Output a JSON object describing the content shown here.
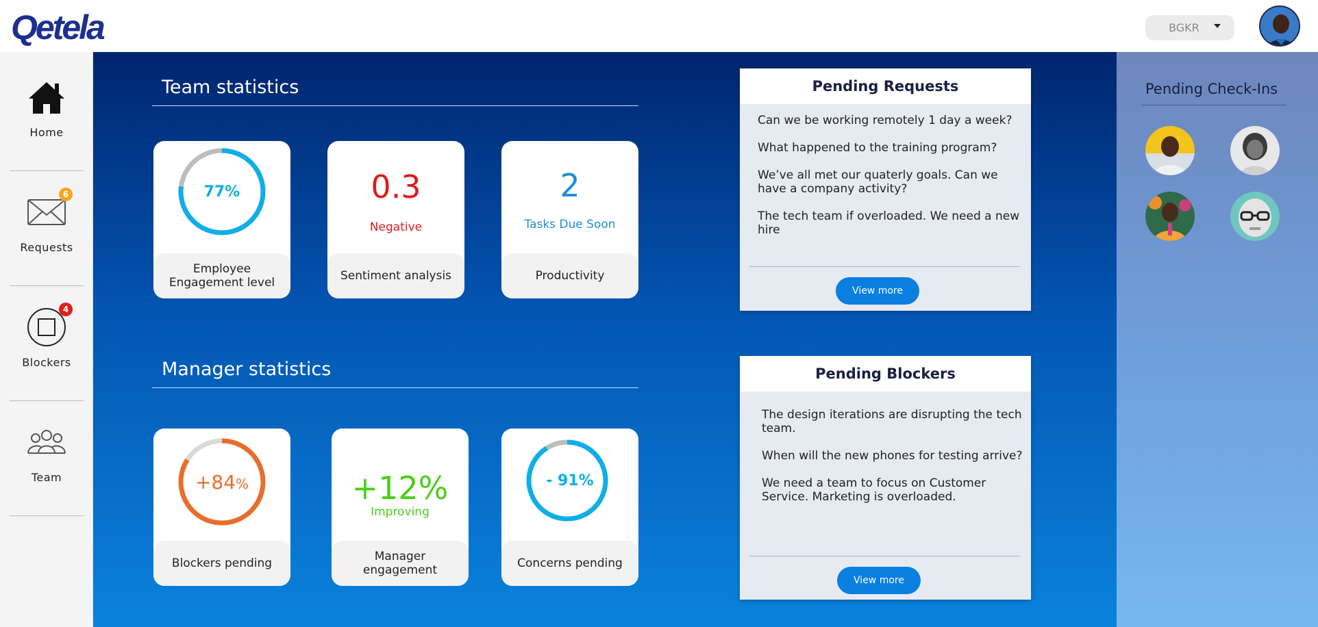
{
  "header": {
    "logo_text": "Qetela",
    "org_select_value": "BGKR",
    "avatar_icon": "user-avatar-icon"
  },
  "sidebar": {
    "items": [
      {
        "label": "Home",
        "icon": "home-icon"
      },
      {
        "label": "Requests",
        "icon": "envelope-icon",
        "badge": "6",
        "badge_color": "#f5a623"
      },
      {
        "label": "Blockers",
        "icon": "square-icon",
        "badge": "4",
        "badge_color": "#e0201c"
      },
      {
        "label": "Team",
        "icon": "team-icon"
      }
    ]
  },
  "team_statistics": {
    "title": "Team statistics",
    "cards": [
      {
        "value": "77%",
        "label": "Employee Engagement level",
        "ring_fraction": 0.77,
        "color": "#10aee8"
      },
      {
        "value": "0.3",
        "sublabel": "Negative",
        "label": "Sentiment analysis",
        "color": "#e01a1a"
      },
      {
        "value": "2",
        "sublabel": "Tasks Due Soon",
        "label": "Productivity",
        "color": "#1e8ed6"
      }
    ]
  },
  "manager_statistics": {
    "title": "Manager statistics",
    "cards": [
      {
        "value_main": "+84",
        "value_unit": "%",
        "label": "Blockers pending",
        "ring_fraction": 0.84,
        "color": "#e86e2c"
      },
      {
        "value": "+12%",
        "sublabel": "Improving",
        "label": "Manager engagement",
        "color": "#4ccd1b"
      },
      {
        "value": "- 91%",
        "label": "Concerns pending",
        "ring_fraction": 0.91,
        "color": "#10aee8"
      }
    ]
  },
  "pending_requests": {
    "title": "Pending Requests",
    "items": [
      "Can we be working remotely 1 day a week?",
      "What happened to the training program?",
      "We’ve all met our quaterly goals. Can we have a company activity?",
      "The tech team if overloaded. We need a new hire"
    ],
    "button_label": "View more"
  },
  "pending_blockers": {
    "title": "Pending Blockers",
    "items": [
      "The design iterations are disrupting the tech team.",
      "When will the new phones for testing arrive?",
      "We need a team to focus on Customer Service. Marketing is overloaded."
    ],
    "button_label": "View more"
  },
  "pending_checkins": {
    "title": "Pending Check-Ins",
    "avatars": [
      "avatar-man-yellow",
      "avatar-woman-grey",
      "avatar-woman-colorful",
      "avatar-robot-teal"
    ]
  },
  "colors": {
    "brand": "#1d2f8f",
    "accent": "#0b7fe0",
    "main_bg_top": "#00256e",
    "main_bg_bottom": "#0a82dc"
  }
}
